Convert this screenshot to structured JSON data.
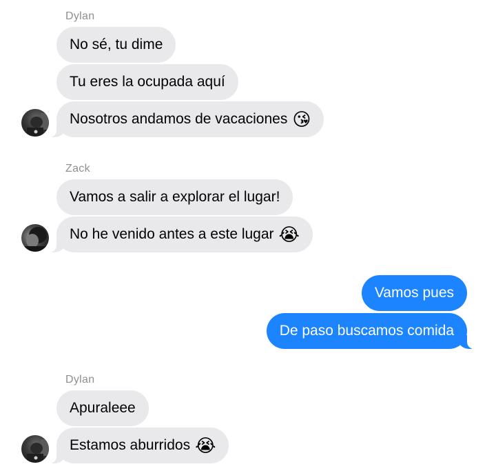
{
  "thread": {
    "groups": [
      {
        "sender": "Dylan",
        "messages": [
          {
            "text": "No sé, tu dime"
          },
          {
            "text": "Tu eres la ocupada aquí"
          },
          {
            "text": "Nosotros andamos de vacaciones",
            "emoji": "😘"
          }
        ]
      },
      {
        "sender": "Zack",
        "messages": [
          {
            "text": "Vamos a salir a explorar el lugar!"
          },
          {
            "text": "No he venido antes a este lugar",
            "emoji": "😭"
          }
        ]
      },
      {
        "sender": "",
        "outgoing": true,
        "messages": [
          {
            "text": "Vamos pues"
          },
          {
            "text": "De paso buscamos comida"
          }
        ]
      },
      {
        "sender": "Dylan",
        "messages": [
          {
            "text": "Apuraleee"
          },
          {
            "text": "Estamos aburridos",
            "emoji": "😭"
          }
        ]
      }
    ]
  },
  "colors": {
    "incoming_bubble": "#e9e9eb",
    "outgoing_bubble": "#1b84fe",
    "sender_name": "#8e8e93"
  }
}
